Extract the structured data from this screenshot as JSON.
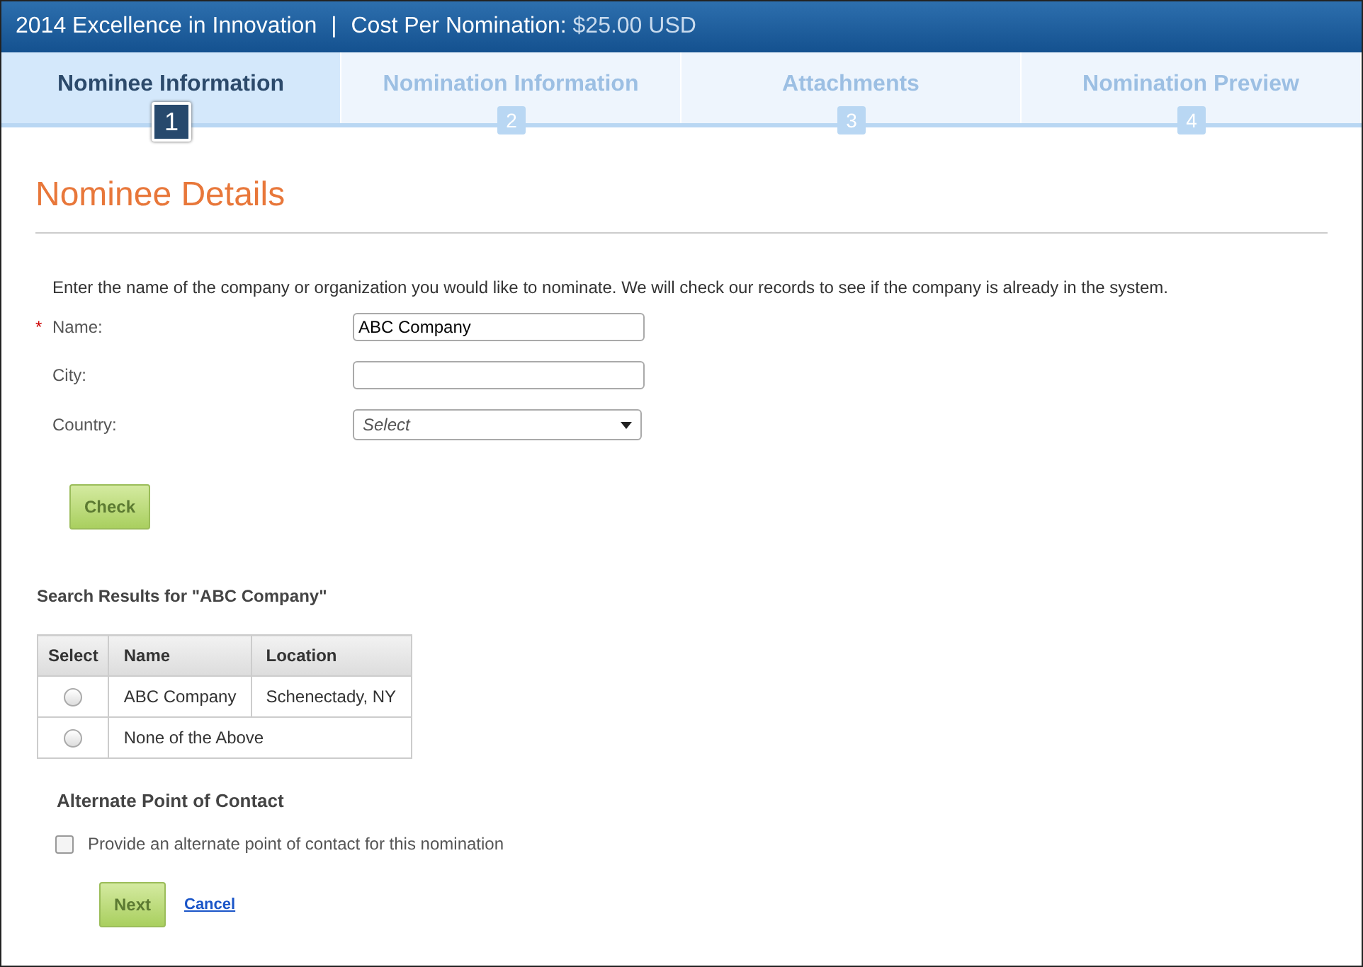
{
  "header": {
    "title": "2014 Excellence in Innovation",
    "separator": "|",
    "cost_label": "Cost Per Nomination:",
    "cost_value": "$25.00 USD"
  },
  "tabs": [
    {
      "label": "Nominee Information",
      "number": "1",
      "selected": true
    },
    {
      "label": "Nomination Information",
      "number": "2",
      "selected": false
    },
    {
      "label": "Attachments",
      "number": "3",
      "selected": false
    },
    {
      "label": "Nomination Preview",
      "number": "4",
      "selected": false
    }
  ],
  "section_title": "Nominee Details",
  "intro": "Enter the name of the company or organization you would like to nominate. We will check our records to see if the company is already in the system.",
  "fields": [
    {
      "kind": "text",
      "label": "Name:",
      "required": true,
      "value": "ABC Company"
    },
    {
      "kind": "text",
      "label": "City:",
      "required": false
    },
    {
      "kind": "select",
      "label": "Country:",
      "required": false,
      "placeholder": "Select"
    }
  ],
  "required_mark": "*",
  "check_button": "Check",
  "results_title": "Search Results for \"ABC Company\"",
  "table": {
    "columns": [
      "Select",
      "Name",
      "Location"
    ],
    "rows": [
      {
        "selected": false,
        "cells": [
          "",
          "ABC Company",
          "Schenectady, NY"
        ]
      },
      {
        "selected": false,
        "cells": [
          "",
          {
            "text": "None of the Above",
            "colspan": 2
          }
        ]
      }
    ]
  },
  "alternate_title": "Alternate Point of Contact",
  "alternate_checkbox": {
    "label": "Provide an alternate point of contact for this nomination",
    "checked": false
  },
  "buttons": {
    "next": "Next",
    "cancel": "Cancel"
  }
}
